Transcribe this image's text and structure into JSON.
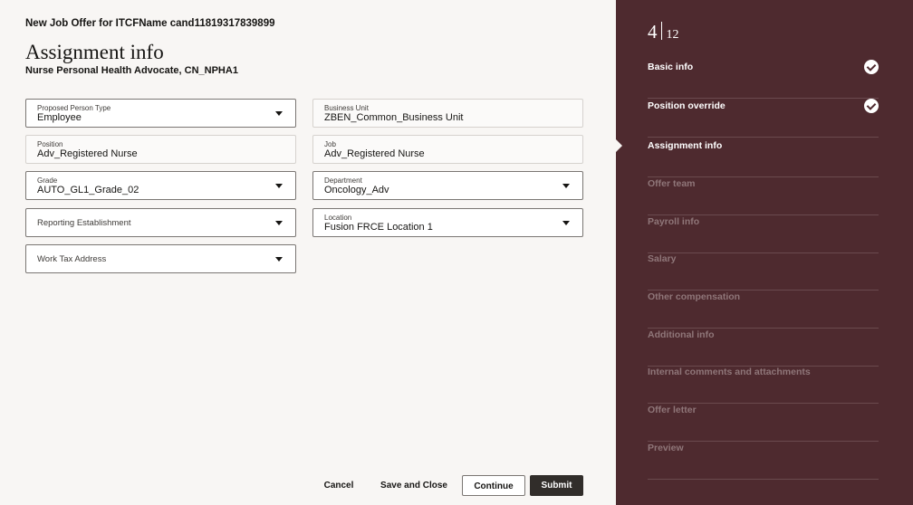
{
  "header": {
    "offer_title": "New Job Offer for ITCFName cand11819317839899",
    "page_title": "Assignment info",
    "page_subtitle": "Nurse Personal Health Advocate, CN_NPHA1"
  },
  "form": {
    "proposed_person_type": {
      "label": "Proposed Person Type",
      "value": "Employee"
    },
    "business_unit": {
      "label": "Business Unit",
      "value": "ZBEN_Common_Business Unit"
    },
    "position": {
      "label": "Position",
      "value": "Adv_Registered Nurse"
    },
    "job": {
      "label": "Job",
      "value": "Adv_Registered Nurse"
    },
    "grade": {
      "label": "Grade",
      "value": "AUTO_GL1_Grade_02"
    },
    "department": {
      "label": "Department",
      "value": "Oncology_Adv"
    },
    "reporting_establishment": {
      "label": "Reporting Establishment",
      "value": ""
    },
    "location": {
      "label": "Location",
      "value": "Fusion FRCE Location 1"
    },
    "work_tax_address": {
      "label": "Work Tax Address",
      "value": ""
    }
  },
  "actions": {
    "cancel": "Cancel",
    "save_and_close": "Save and Close",
    "continue": "Continue",
    "submit": "Submit"
  },
  "train": {
    "current": "4",
    "total": "12",
    "steps": [
      {
        "label": "Basic info",
        "status": "done"
      },
      {
        "label": "Position override",
        "status": "done"
      },
      {
        "label": "Assignment info",
        "status": "current"
      },
      {
        "label": "Offer team",
        "status": "future"
      },
      {
        "label": "Payroll info",
        "status": "future"
      },
      {
        "label": "Salary",
        "status": "future"
      },
      {
        "label": "Other compensation",
        "status": "future"
      },
      {
        "label": "Additional info",
        "status": "future"
      },
      {
        "label": "Internal comments and attachments",
        "status": "future"
      },
      {
        "label": "Offer letter",
        "status": "future"
      },
      {
        "label": "Preview",
        "status": "future"
      }
    ]
  },
  "colors": {
    "sidebar_bg": "#4e2a2f",
    "page_bg": "#f8f6f4",
    "primary_button": "#312d2a"
  }
}
